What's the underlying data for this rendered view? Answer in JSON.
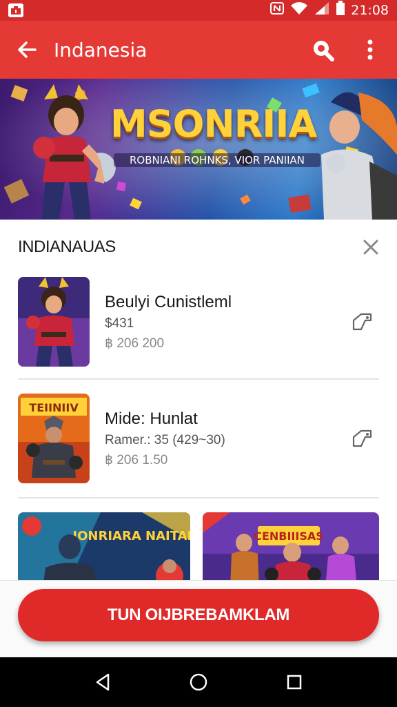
{
  "status_bar": {
    "time": "21:08",
    "icons": [
      "app-notification-icon",
      "nfc-icon",
      "wifi-icon",
      "signal-icon",
      "battery-icon"
    ]
  },
  "app_bar": {
    "title": "Indanesia",
    "back_icon": "arrow-left-icon",
    "search_icon": "search-icon",
    "more_icon": "more-vertical-icon"
  },
  "banner": {
    "title": "MSONRIIA",
    "subtitle": "ROBNIANI ROHNKS, VIOR PANIIAN"
  },
  "section": {
    "title": "INDIANAUAS",
    "close_icon": "close-icon"
  },
  "items": [
    {
      "title": "Beulyi Cunistleml",
      "subtitle": "$431",
      "meta": "฿ 206 200",
      "action_icon": "tag-icon"
    },
    {
      "title": "Mide: Hunlat",
      "subtitle": "Ramer.: 35 (429~30)",
      "meta": "฿ 206 1.50",
      "action_icon": "tag-icon"
    }
  ],
  "cards": [
    {
      "label": "IONRIARA NAITAN"
    },
    {
      "label": "CENBIIISAS"
    }
  ],
  "thumb_labels": {
    "second": "TEIINIIV"
  },
  "cta": {
    "label": "TUN OIJBREBAMKLAM"
  },
  "nav": {
    "icons": [
      "back-triangle-icon",
      "home-circle-icon",
      "recents-square-icon"
    ]
  },
  "colors": {
    "primary": "#e53935",
    "status": "#d42a2a",
    "cta": "#e02a2a",
    "navbar": "#000000"
  }
}
